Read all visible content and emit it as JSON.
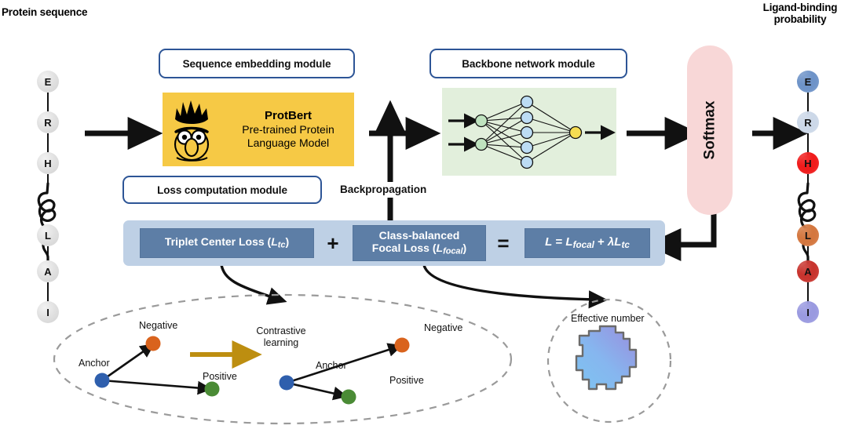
{
  "figure": {
    "title_left": "Protein sequence",
    "title_right_line1": "Ligand-binding",
    "title_right_line2": "probability"
  },
  "input_chain": {
    "residues": [
      "E",
      "R",
      "H",
      "L",
      "A",
      "I"
    ],
    "color": "#e2e2e2"
  },
  "output_chain": {
    "residues": [
      {
        "letter": "E",
        "color": "#6e93c8"
      },
      {
        "letter": "R",
        "color": "#ccd8e8"
      },
      {
        "letter": "H",
        "color": "#f01b1b"
      },
      {
        "letter": "L",
        "color": "#d4773f"
      },
      {
        "letter": "A",
        "color": "#c8342e"
      },
      {
        "letter": "I",
        "color": "#9a9ae0"
      }
    ]
  },
  "sequence_embedding_module": {
    "title": "Sequence embedding module",
    "card": {
      "name": "ProtBert",
      "line1": "Pre-trained Protein",
      "line2": "Language Model",
      "bg": "#f6c945",
      "icon": "bert-character-icon"
    }
  },
  "backbone_network_module": {
    "title": "Backbone network module",
    "bg": "#e2efdc",
    "input_nodes": 2,
    "hidden_nodes": 5,
    "output_nodes": 1,
    "input_node_color": "#bfe3bf",
    "hidden_node_color": "#bcdcf4",
    "output_node_color": "#f5dd52"
  },
  "softmax": {
    "label": "Softmax",
    "bg": "#f8d7d7"
  },
  "loss_computation_module": {
    "title": "Loss computation module",
    "panel_bg": "#bed0e5",
    "box_bg": "#5d7ea6",
    "triplet_loss": {
      "name": "Triplet Center Loss",
      "symbol": "L",
      "subscript": "tc"
    },
    "plus": "+",
    "focal_loss": {
      "line1": "Class-balanced",
      "line2": "Focal Loss",
      "symbol": "L",
      "subscript": "focal"
    },
    "equals": "=",
    "total_loss_equation": "L = L_focal + λL_tc",
    "equation_parts": {
      "lhs": "L",
      "eq": "=",
      "term1_symbol": "L",
      "term1_sub": "focal",
      "op": "+",
      "lambda": "λ",
      "term2_symbol": "L",
      "term2_sub": "tc"
    }
  },
  "backpropagation": {
    "label": "Backpropagation"
  },
  "contrastive_panel": {
    "arrow_label_line1": "Contrastive",
    "arrow_label_line2": "learning",
    "arrow_color": "#bd8e10",
    "before": {
      "anchor": "Anchor",
      "negative": "Negative",
      "positive": "Positive"
    },
    "after": {
      "anchor": "Anchor",
      "negative": "Negative",
      "positive": "Positive"
    },
    "colors": {
      "anchor": "#2f5fad",
      "negative": "#d9631d",
      "positive": "#4a8b35"
    }
  },
  "effective_number_panel": {
    "label": "Effective number",
    "blob_gradient_from": "#9a8ddd",
    "blob_gradient_to": "#7ec4f0"
  }
}
